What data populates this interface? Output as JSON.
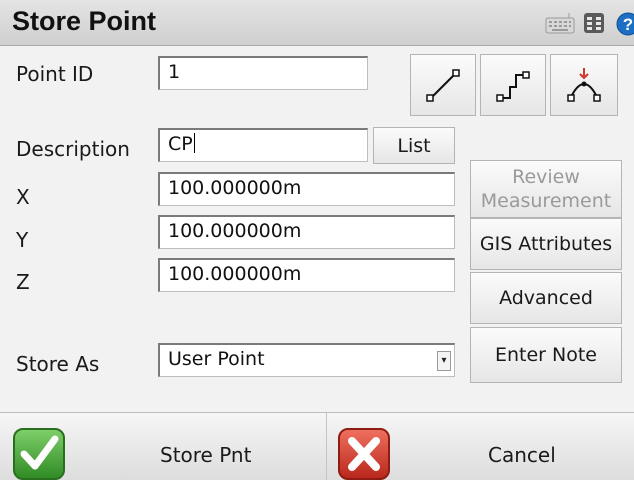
{
  "window": {
    "title": "Store Point"
  },
  "titlebar_icons": [
    "keyboard-icon",
    "grid-icon",
    "help-icon"
  ],
  "form": {
    "point_id_label": "Point ID",
    "point_id_value": "1",
    "description_label": "Description",
    "description_value": "CP",
    "x_label": "X",
    "x_value": "100.000000m",
    "y_label": "Y",
    "y_value": "100.000000m",
    "z_label": "Z",
    "z_value": "100.000000m",
    "store_as_label": "Store As",
    "store_as_value": "User Point"
  },
  "buttons": {
    "list": "List",
    "review_line1": "Review",
    "review_line2": "Measurement",
    "gis": "GIS Attributes",
    "advanced": "Advanced",
    "note": "Enter Note"
  },
  "bottom": {
    "store": "Store Pnt",
    "cancel": "Cancel"
  },
  "colors": {
    "accent_green": "#4aa63a",
    "cancel_red": "#d0352a",
    "help_blue": "#1d6fc4"
  }
}
